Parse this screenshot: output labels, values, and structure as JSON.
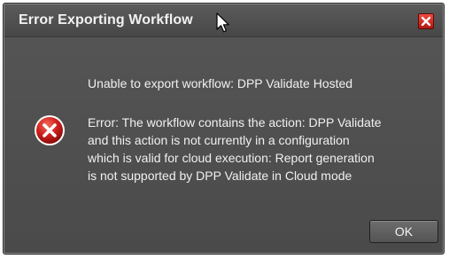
{
  "dialog": {
    "title": "Error Exporting Workflow",
    "close_icon": "close-icon",
    "error_icon": "error-icon",
    "headline": "Unable to export workflow: DPP Validate Hosted",
    "detail_lines": [
      "Error: The workflow contains the action: DPP Validate",
      "and this action is not currently in a configuration",
      "which is valid for cloud execution: Report generation",
      "is not supported by DPP Validate in Cloud mode"
    ],
    "ok_label": "OK"
  },
  "colors": {
    "window_bg": "#4d4d4d",
    "text": "#f0f0f0",
    "close_red": "#d42a20",
    "error_red": "#c8161b"
  }
}
